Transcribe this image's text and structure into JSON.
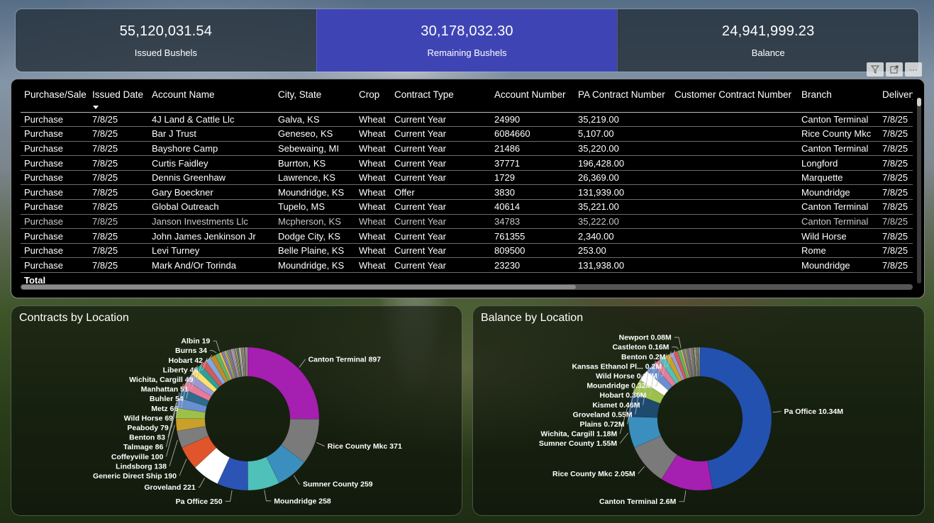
{
  "kpis": [
    {
      "value": "55,120,031.54",
      "label": "Issued Bushels"
    },
    {
      "value": "30,178,032.30",
      "label": "Remaining Bushels"
    },
    {
      "value": "24,941,999.23",
      "label": "Balance"
    }
  ],
  "colors": {
    "kpi_active": "#3f44b5",
    "table_bg": "#000000"
  },
  "visual_icons": [
    "filter-icon",
    "focus-mode-icon",
    "more-options-icon"
  ],
  "table": {
    "columns": [
      "Purchase/Sale",
      "Issued Date",
      "Account Name",
      "City, State",
      "Crop",
      "Contract Type",
      "Account Number",
      "PA Contract Number",
      "Customer Contract Number",
      "Branch",
      "Delivery"
    ],
    "sorted_column": "Issued Date",
    "rows": [
      [
        "Purchase",
        "7/8/25",
        "4J Land & Cattle Llc",
        "Galva, KS",
        "Wheat",
        "Current Year",
        "24990",
        "35,219.00",
        "",
        "Canton Terminal",
        "7/8/25"
      ],
      [
        "Purchase",
        "7/8/25",
        "Bar J Trust",
        "Geneseo, KS",
        "Wheat",
        "Current Year",
        "6084660",
        "5,107.00",
        "",
        "Rice County Mkc",
        "7/8/25"
      ],
      [
        "Purchase",
        "7/8/25",
        "Bayshore Camp",
        "Sebewaing, MI",
        "Wheat",
        "Current Year",
        "21486",
        "35,220.00",
        "",
        "Canton Terminal",
        "7/8/25"
      ],
      [
        "Purchase",
        "7/8/25",
        "Curtis Faidley",
        "Burrton, KS",
        "Wheat",
        "Current Year",
        "37771",
        "196,428.00",
        "",
        "Longford",
        "7/8/25"
      ],
      [
        "Purchase",
        "7/8/25",
        "Dennis Greenhaw",
        "Lawrence, KS",
        "Wheat",
        "Current Year",
        "1729",
        "26,369.00",
        "",
        "Marquette",
        "7/8/25"
      ],
      [
        "Purchase",
        "7/8/25",
        "Gary Boeckner",
        "Moundridge, KS",
        "Wheat",
        "Offer",
        "3830",
        "131,939.00",
        "",
        "Moundridge",
        "7/8/25"
      ],
      [
        "Purchase",
        "7/8/25",
        "Global Outreach",
        "Tupelo, MS",
        "Wheat",
        "Current Year",
        "40614",
        "35,221.00",
        "",
        "Canton Terminal",
        "7/8/25"
      ],
      [
        "Purchase",
        "7/8/25",
        "Janson Investments Llc",
        "Mcpherson, KS",
        "Wheat",
        "Current Year",
        "34783",
        "35,222.00",
        "",
        "Canton Terminal",
        "7/8/25"
      ],
      [
        "Purchase",
        "7/8/25",
        "John James Jenkinson Jr",
        "Dodge City, KS",
        "Wheat",
        "Current Year",
        "761355",
        "2,340.00",
        "",
        "Wild Horse",
        "7/8/25"
      ],
      [
        "Purchase",
        "7/8/25",
        "Levi Turney",
        "Belle Plaine, KS",
        "Wheat",
        "Current Year",
        "809500",
        "253.00",
        "",
        "Rome",
        "7/8/25"
      ],
      [
        "Purchase",
        "7/8/25",
        "Mark And/Or Torinda",
        "Moundridge, KS",
        "Wheat",
        "Current Year",
        "23230",
        "131,938.00",
        "",
        "Moundridge",
        "7/8/25"
      ]
    ],
    "total_label": "Total"
  },
  "chart_data": [
    {
      "type": "pie",
      "donut": true,
      "title": "Contracts by Location",
      "slices": [
        {
          "label": "Canton Terminal",
          "value": 897,
          "display": "897",
          "color": "#a51fb0"
        },
        {
          "label": "Rice County Mkc",
          "value": 371,
          "display": "371",
          "color": "#7a7a7a"
        },
        {
          "label": "Sumner County",
          "value": 259,
          "display": "259",
          "color": "#3a8fbf"
        },
        {
          "label": "Moundridge",
          "value": 258,
          "display": "258",
          "color": "#4fc1b9"
        },
        {
          "label": "Pa Office",
          "value": 250,
          "display": "250",
          "color": "#2c54b5"
        },
        {
          "label": "Groveland",
          "value": 221,
          "display": "221",
          "color": "#ffffff"
        },
        {
          "label": "Generic Direct Ship",
          "value": 190,
          "display": "190",
          "color": "#e0552b"
        },
        {
          "label": "Lindsborg",
          "value": 138,
          "display": "138",
          "color": "#7d7d7d"
        },
        {
          "label": "Coffeyville",
          "value": 100,
          "display": "100",
          "color": "#c9a02a"
        },
        {
          "label": "Talmage",
          "value": 86,
          "display": "86",
          "color": "#9cc04a"
        },
        {
          "label": "Benton",
          "value": 83,
          "display": "83",
          "color": "#6a8fd0"
        },
        {
          "label": "Peabody",
          "value": 79,
          "display": "79",
          "color": "#2f6b8f"
        },
        {
          "label": "Wild Horse",
          "value": 69,
          "display": "69",
          "color": "#e87a9a"
        },
        {
          "label": "Metz",
          "value": 66,
          "display": "66",
          "color": "#9b9ad5"
        },
        {
          "label": "Buhler",
          "value": 54,
          "display": "54",
          "color": "#ffe36e"
        },
        {
          "label": "Manhattan",
          "value": 51,
          "display": "51",
          "color": "#2aa198"
        },
        {
          "label": "Wichita, Cargill",
          "value": 49,
          "display": "49",
          "color": "#d45a5a"
        },
        {
          "label": "Liberty",
          "value": 46,
          "display": "46",
          "color": "#7fa8e0"
        },
        {
          "label": "Hobart",
          "value": 42,
          "display": "42",
          "color": "#c48a2a"
        },
        {
          "label": "Burns",
          "value": 34,
          "display": "34",
          "color": "#5fb36b"
        },
        {
          "label": "Albin",
          "value": 19,
          "display": "19",
          "color": "#d4c94a"
        }
      ]
    },
    {
      "type": "pie",
      "donut": true,
      "title": "Balance by Location",
      "slices": [
        {
          "label": "Pa Office",
          "value": 10.34,
          "display": "10.34M",
          "color": "#2351b0"
        },
        {
          "label": "Canton Terminal",
          "value": 2.6,
          "display": "2.6M",
          "color": "#a51fb0"
        },
        {
          "label": "Rice County Mkc",
          "value": 2.05,
          "display": "2.05M",
          "color": "#7a7a7a"
        },
        {
          "label": "Sumner County",
          "value": 1.55,
          "display": "1.55M",
          "color": "#3a8fbf"
        },
        {
          "label": "Wichita, Cargill",
          "value": 1.18,
          "display": "1.18M",
          "color": "#1e4a6e"
        },
        {
          "label": "Plains",
          "value": 0.72,
          "display": "0.72M",
          "color": "#9cc04a"
        },
        {
          "label": "Groveland",
          "value": 0.55,
          "display": "0.55M",
          "color": "#ffffff"
        },
        {
          "label": "Kismet",
          "value": 0.46,
          "display": "0.46M",
          "color": "#6a8fd0"
        },
        {
          "label": "Hobart",
          "value": 0.36,
          "display": "0.36M",
          "color": "#e87a9a"
        },
        {
          "label": "Moundridge",
          "value": 0.32,
          "display": "0.32M",
          "color": "#4fc1b9"
        },
        {
          "label": "Wild Horse",
          "value": 0.27,
          "display": "0.27M",
          "color": "#c9a02a"
        },
        {
          "label": "Kansas Ethanol Pl...",
          "value": 0.2,
          "display": "0.2M",
          "color": "#9b9ad5"
        },
        {
          "label": "Benton",
          "value": 0.2,
          "display": "0.2M",
          "color": "#d45a5a"
        },
        {
          "label": "Castleton",
          "value": 0.16,
          "display": "0.16M",
          "color": "#5fb36b"
        },
        {
          "label": "Newport",
          "value": 0.08,
          "display": "0.08M",
          "color": "#d4c94a"
        }
      ]
    }
  ]
}
